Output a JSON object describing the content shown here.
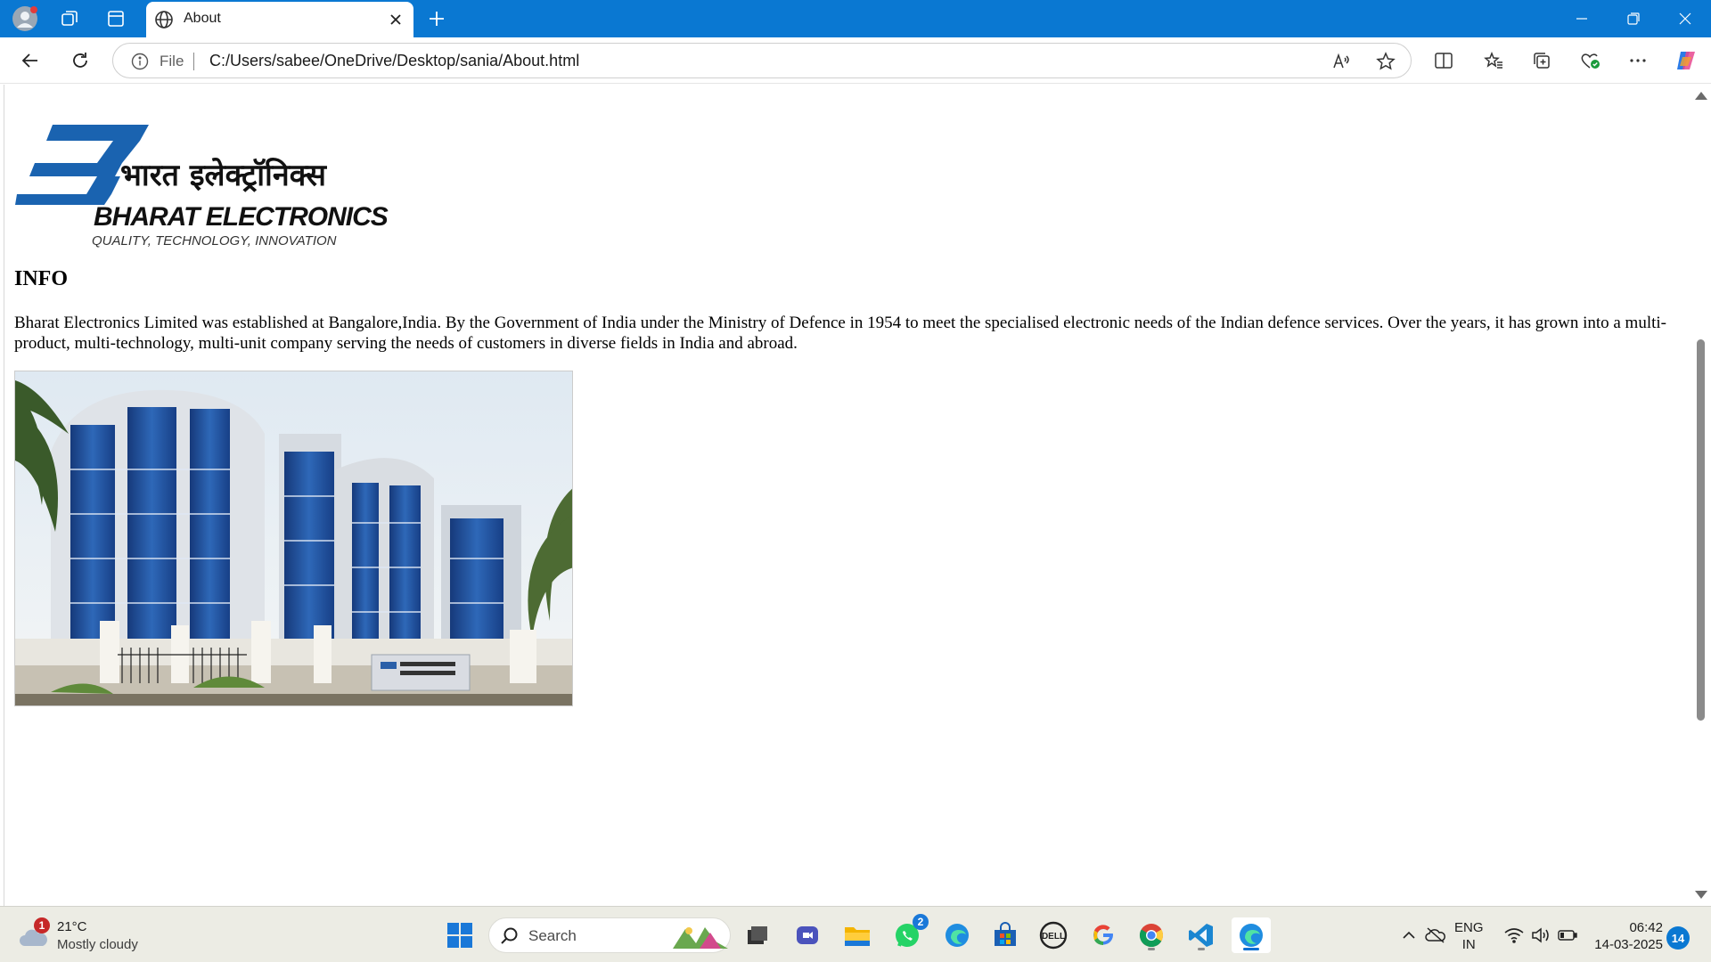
{
  "browser": {
    "tab": {
      "title": "About",
      "favicon": "globe-icon"
    },
    "address": {
      "scheme_label": "File",
      "url": "C:/Users/sabee/OneDrive/Desktop/sania/About.html"
    },
    "accent_color": "#0a78d2"
  },
  "page": {
    "logo": {
      "hindi_text": "भारत इलेक्ट्रॉनिक्स",
      "name": "BHARAT ELECTRONICS",
      "tagline": "QUALITY, TECHNOLOGY, INNOVATION"
    },
    "heading": "INFO",
    "paragraph": "Bharat Electronics Limited was established at Bangalore,India. By the Government of India under the Ministry of Defence in 1954 to meet the specialised electronic needs of the Indian defence services. Over the years, it has grown into a multi-product, multi-technology, multi-unit company serving the needs of customers in diverse fields in India and abroad.",
    "photo": {
      "alt": "BEL office building"
    }
  },
  "taskbar": {
    "weather": {
      "temp": "21°C",
      "desc": "Mostly cloudy",
      "badge": "1"
    },
    "search_label": "Search",
    "whatsapp_badge": "2",
    "lang_top": "ENG",
    "lang_bottom": "IN",
    "time": "06:42",
    "date": "14-03-2025",
    "notification_count": "14"
  }
}
